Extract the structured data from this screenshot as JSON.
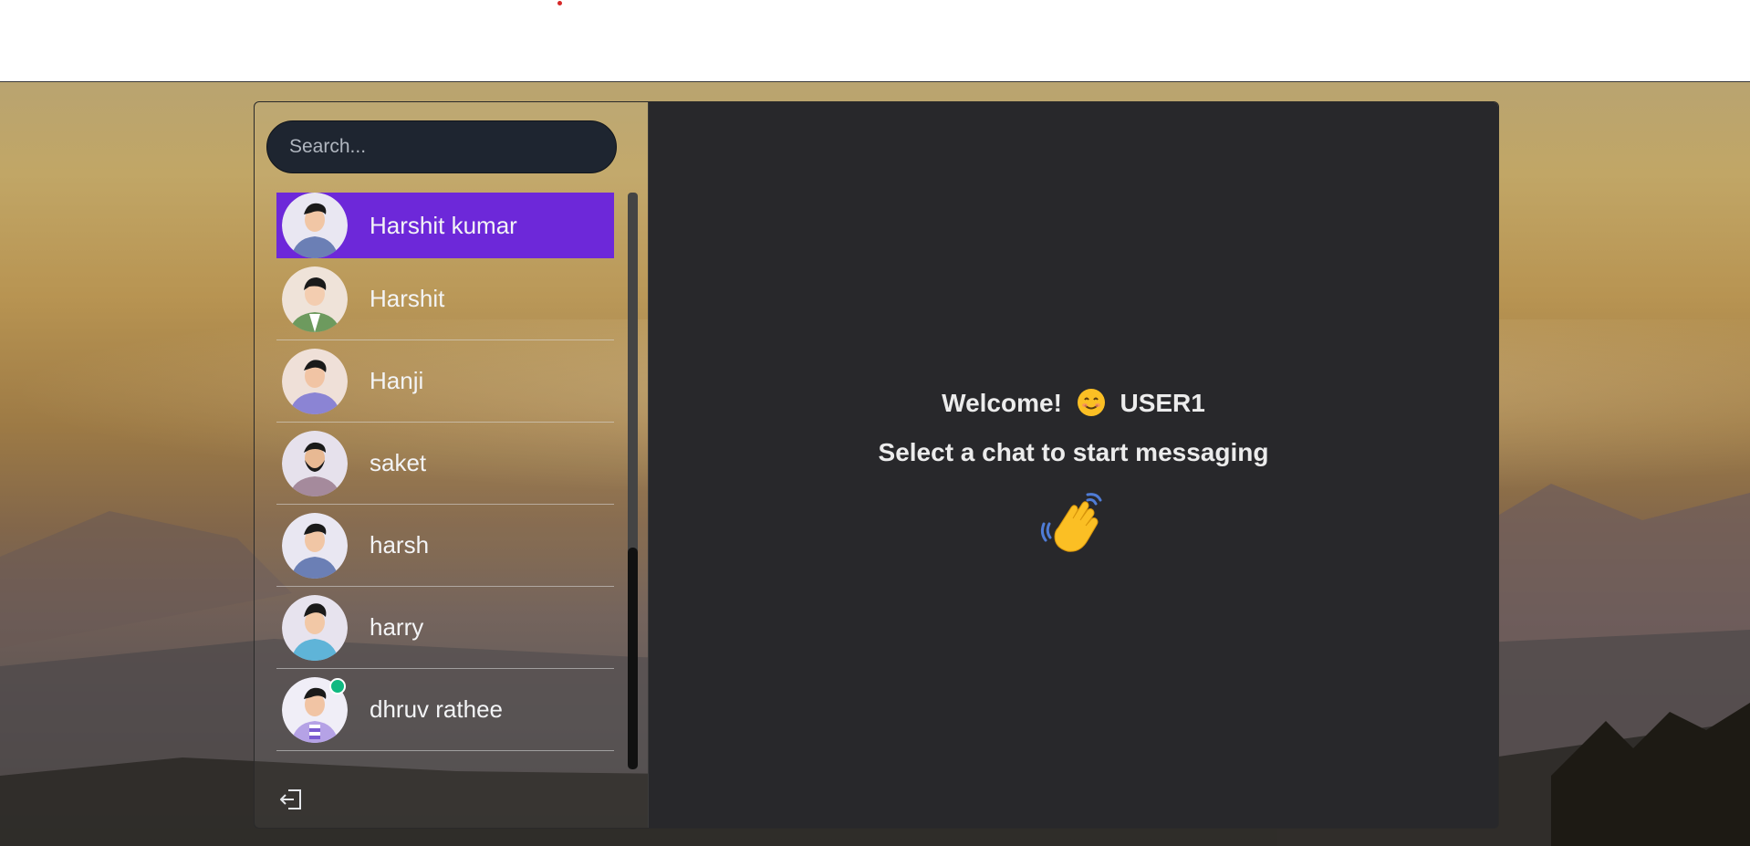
{
  "search": {
    "placeholder": "Search..."
  },
  "contacts": [
    {
      "name": "Harshit kumar",
      "active": true,
      "online": false,
      "avatar": "avatar-boy-blue-shirt"
    },
    {
      "name": "Harshit",
      "active": false,
      "online": false,
      "avatar": "avatar-boy-green-jacket"
    },
    {
      "name": "Hanji",
      "active": false,
      "online": false,
      "avatar": "avatar-boy-purple-hoodie"
    },
    {
      "name": "saket",
      "active": false,
      "online": false,
      "avatar": "avatar-man-beard"
    },
    {
      "name": "harsh",
      "active": false,
      "online": false,
      "avatar": "avatar-boy-blue-shirt"
    },
    {
      "name": "harry",
      "active": false,
      "online": false,
      "avatar": "avatar-boy-cyan-shirt"
    },
    {
      "name": "dhruv rathee",
      "active": false,
      "online": true,
      "avatar": "avatar-boy-striped-shirt"
    }
  ],
  "sidebar": {
    "logout_icon": "logout-icon"
  },
  "chat": {
    "welcome_text": "Welcome!",
    "welcome_emoji": "smiling-face-emoji",
    "username": "USER1",
    "select_prompt": "Select a chat to start messaging",
    "wave_icon": "waving-hand-emoji"
  },
  "colors": {
    "active_contact": "#6d28d9",
    "chat_background": "#28282b",
    "online_indicator": "#10b981",
    "search_background": "#1e2530"
  }
}
